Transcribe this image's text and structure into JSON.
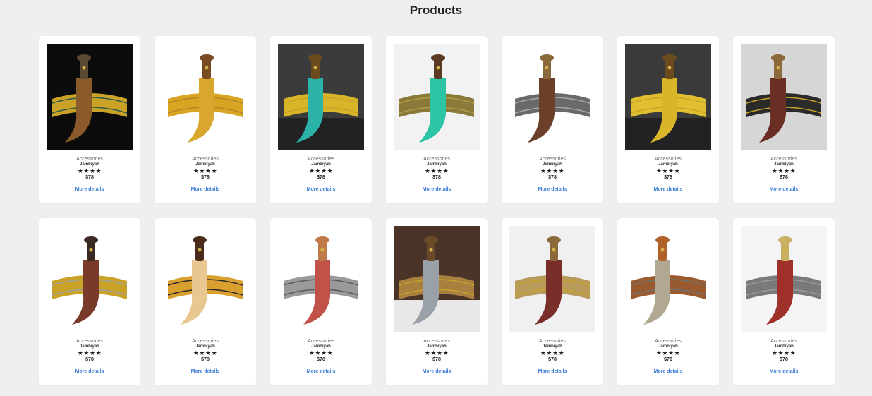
{
  "header": {
    "title": "Products"
  },
  "products": [
    {
      "category": "Accessories",
      "name": "Jambiyah",
      "rating_stars": "★★★★",
      "price": "$78",
      "details_label": "More details",
      "image": "jambiya-dark-background"
    },
    {
      "category": "Accessories",
      "name": "Jambiyah",
      "rating_stars": "★★★★",
      "price": "$78",
      "details_label": "More details",
      "image": "jambiya-gold-belt"
    },
    {
      "category": "Accessories",
      "name": "Jambiyah",
      "rating_stars": "★★★★",
      "price": "$78",
      "details_label": "More details",
      "image": "jambiya-stone-wall-teal"
    },
    {
      "category": "Accessories",
      "name": "Jambiyah",
      "rating_stars": "★★★★",
      "price": "$78",
      "details_label": "More details",
      "image": "jambiya-teal-sheath"
    },
    {
      "category": "Accessories",
      "name": "Jambiyah",
      "rating_stars": "★★★★",
      "price": "$78",
      "details_label": "More details",
      "image": "jambiya-brown-sheath"
    },
    {
      "category": "Accessories",
      "name": "Jambiyah",
      "rating_stars": "★★★★",
      "price": "$78",
      "details_label": "More details",
      "image": "jambiya-stone-wall-gold"
    },
    {
      "category": "Accessories",
      "name": "Jambiyah",
      "rating_stars": "★★★★",
      "price": "$78",
      "details_label": "More details",
      "image": "jambiya-grey-background"
    },
    {
      "category": "Accessories",
      "name": "Jambiyah",
      "rating_stars": "★★★★",
      "price": "$78",
      "details_label": "More details",
      "image": "jambiya-blade-out"
    },
    {
      "category": "Accessories",
      "name": "Jambiyah",
      "rating_stars": "★★★★",
      "price": "$78",
      "details_label": "More details",
      "image": "jambiya-wooden-sheath"
    },
    {
      "category": "Accessories",
      "name": "Jambiyah",
      "rating_stars": "★★★★",
      "price": "$78",
      "details_label": "More details",
      "image": "jambiya-red-sheath"
    },
    {
      "category": "Accessories",
      "name": "Jambiyah",
      "rating_stars": "★★★★",
      "price": "$78",
      "details_label": "More details",
      "image": "jambiya-worn-on-belt"
    },
    {
      "category": "Accessories",
      "name": "Jambiyah",
      "rating_stars": "★★★★",
      "price": "$78",
      "details_label": "More details",
      "image": "jambiya-maroon-belt"
    },
    {
      "category": "Accessories",
      "name": "Jambiyah",
      "rating_stars": "★★★★",
      "price": "$78",
      "details_label": "More details",
      "image": "jambiya-silver-ornate"
    },
    {
      "category": "Accessories",
      "name": "Jambiyah",
      "rating_stars": "★★★★",
      "price": "$78",
      "details_label": "More details",
      "image": "jambiya-red-curve"
    }
  ],
  "colors": {
    "background": "#efefef",
    "card": "#ffffff",
    "link": "#3a7bd5"
  }
}
